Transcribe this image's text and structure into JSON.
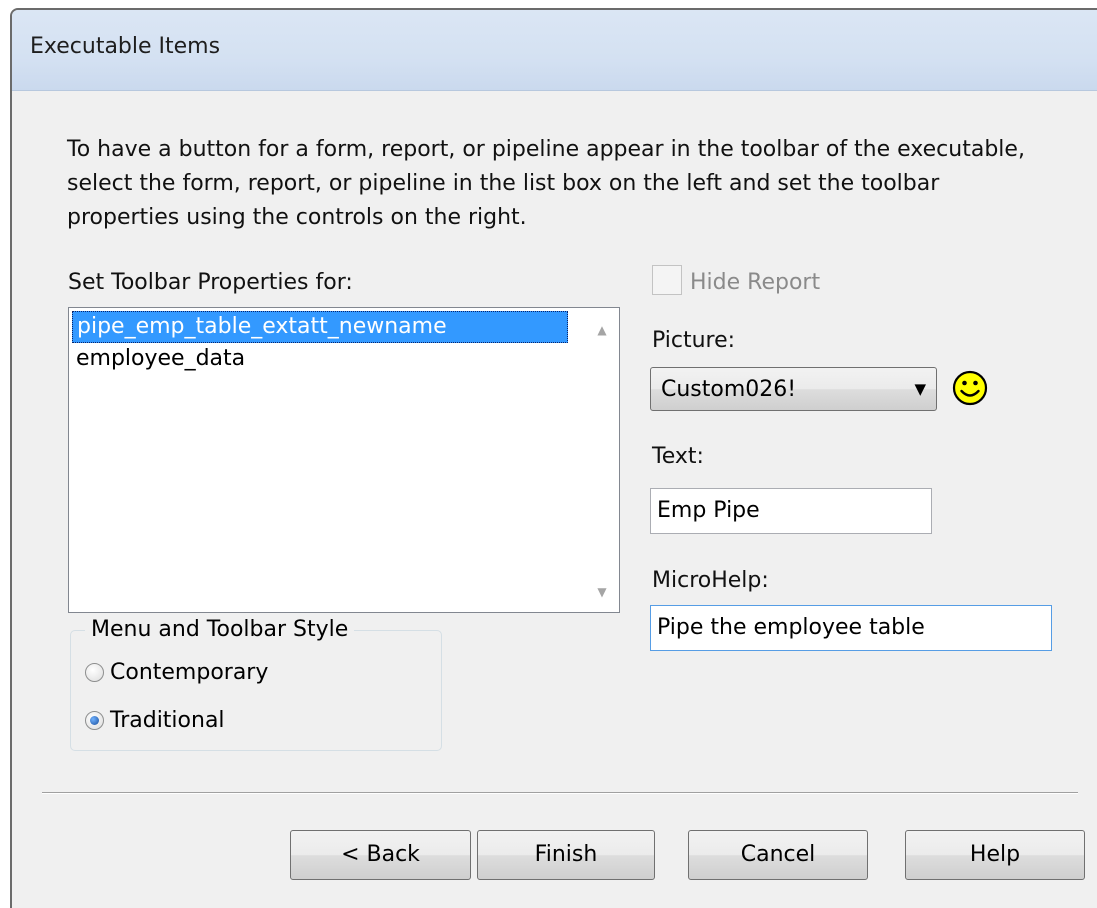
{
  "header": {
    "title": "Executable Items"
  },
  "description": "To have a button for a form, report, or pipeline appear in the toolbar of the executable, select the form, report, or pipeline in the list box on the left and set the toolbar properties using the controls on the right.",
  "left": {
    "list_label": "Set Toolbar Properties for:",
    "list_items": [
      "pipe_emp_table_extatt_newname",
      "employee_data"
    ],
    "selected_index": 0,
    "style_group": {
      "legend": "Menu and Toolbar Style",
      "options": [
        "Contemporary",
        "Traditional"
      ],
      "selected": "Traditional"
    }
  },
  "right": {
    "hide_report": {
      "label": "Hide Report",
      "checked": false,
      "enabled": false
    },
    "picture": {
      "label": "Picture:",
      "value": "Custom026!",
      "icon": "smiley-face-icon"
    },
    "text": {
      "label": "Text:",
      "value": "Emp Pipe"
    },
    "microhelp": {
      "label": "MicroHelp:",
      "value": "Pipe the employee table"
    }
  },
  "buttons": {
    "back": "< Back",
    "finish": "Finish",
    "cancel": "Cancel",
    "help": "Help"
  },
  "colors": {
    "selection": "#3399ff",
    "header_bg": "#d4e1f2",
    "dialog_bg": "#f0f0f0"
  }
}
